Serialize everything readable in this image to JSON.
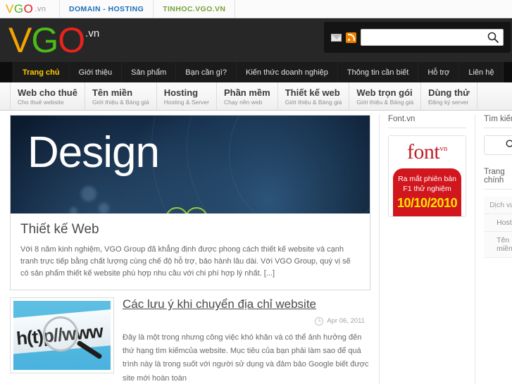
{
  "topbar": {
    "logo": {
      "v": "V",
      "g": "G",
      "o": "O",
      "tld": ".vn"
    },
    "links": [
      {
        "label": "DOMAIN - HOSTING",
        "color": "#1c6fb5"
      },
      {
        "label": "TINHOC.VGO.VN",
        "color": "#74a339"
      }
    ]
  },
  "masthead": {
    "brand": {
      "v": "V",
      "g": "G",
      "o": "O",
      "tld": ".vn"
    },
    "icons": [
      "mail-icon",
      "rss-icon"
    ],
    "search": {
      "value": "",
      "placeholder": "",
      "button": "search-icon"
    }
  },
  "mainnav": {
    "items": [
      {
        "label": "Trang chủ",
        "active": true
      },
      {
        "label": "Giới thiệu",
        "active": false
      },
      {
        "label": "Sản phẩm",
        "active": false
      },
      {
        "label": "Bạn cần gì?",
        "active": false
      },
      {
        "label": "Kiến thức doanh nghiệp",
        "active": false
      },
      {
        "label": "Thông tin cần biết",
        "active": false
      },
      {
        "label": "Hỗ trợ",
        "active": false
      },
      {
        "label": "Liên hệ",
        "active": false
      }
    ],
    "active_color": "#ffcc00"
  },
  "servicebar": {
    "items": [
      {
        "title": "Web cho thuê",
        "sub": "Cho thuê website"
      },
      {
        "title": "Tên miền",
        "sub": "Giới thiệu & Bảng giá"
      },
      {
        "title": "Hosting",
        "sub": "Hosting & Server"
      },
      {
        "title": "Phần mềm",
        "sub": "Chạy nền web"
      },
      {
        "title": "Thiết kế web",
        "sub": "Giới thiệu & Bảng giá"
      },
      {
        "title": "Web trọn gói",
        "sub": "Giới thiệu & Bảng giá"
      },
      {
        "title": "Dùng thử",
        "sub": "Đăng ký server"
      }
    ]
  },
  "feature": {
    "hero_word": "Design",
    "title": "Thiết kế Web",
    "text": "Với 8 năm kinh nghiệm, VGO Group đã khẳng định được phong cách thiết kế website và cạnh tranh trực tiếp bằng chất lượng cùng chế độ hỗ trợ, bảo hành lâu dài. Với VGO Group, quý vị sẽ có sản phẩm thiết kế website phù hợp nhu cầu với chi phí hợp lý nhất. [...]"
  },
  "article": {
    "thumb_text": "h(t)p//www",
    "title": "Các lưu ý khi chuyển địa chỉ website",
    "date": "Apr 06, 2011",
    "date_icon": "clock-icon",
    "text": "Đây là một trong nhưng công việc khó khăn và có thể ảnh hưởng đến thứ hạng tìm kiếmcủa website. Mục tiêu của bạn phải làm sao để quá trình này là trong suốt với người sử dụng và đảm bảo Google biết được site mới hoàn toàn"
  },
  "font_widget": {
    "heading": "Font.vn",
    "logo_main": "font",
    "logo_sup": "vn",
    "promo_line1": "Ra mắt phiên bản",
    "promo_line2": "F1 thử nghiệm",
    "promo_date": "10/10/2010",
    "promo_bg": "#d1161d",
    "promo_date_color": "#ffe400"
  },
  "sidebar": {
    "search_heading": "Tìm kiếm",
    "search_value": "",
    "search_placeholder": "",
    "menu_heading": "Trang chính",
    "menu_items": [
      {
        "label": "Dịch vụ",
        "sub": false
      },
      {
        "label": "Hosting",
        "sub": true
      },
      {
        "label": "Tên miền",
        "sub": true
      }
    ]
  }
}
